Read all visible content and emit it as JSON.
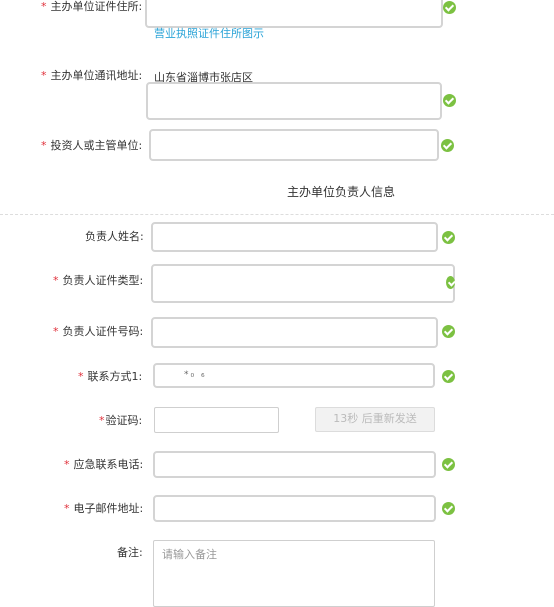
{
  "required_mark": "*",
  "fields": {
    "cert_address": {
      "label": "主办单位证件住所:",
      "link": "营业执照证件住所图示"
    },
    "mail_address": {
      "label": "主办单位通讯地址:",
      "prefix": "山东省淄博市张店区"
    },
    "investor": {
      "label": "投资人或主管单位:"
    },
    "section_title": "主办单位负责人信息",
    "leader_name": {
      "label": "负责人姓名:"
    },
    "leader_id_type": {
      "label": "负责人证件类型:"
    },
    "leader_id_no": {
      "label": "负责人证件号码:"
    },
    "contact1": {
      "label": "联系方式1:",
      "value": "*₀  ₆"
    },
    "verify_code": {
      "label": "验证码:",
      "resend": "13秒 后重新发送"
    },
    "emergency_phone": {
      "label": "应急联系电话:"
    },
    "email": {
      "label": "电子邮件地址:"
    },
    "remark": {
      "label": "备注:",
      "placeholder": "请输入备注"
    }
  },
  "colors": {
    "required": "#e0303a",
    "check": "#7cc142",
    "link": "#29a3d7",
    "border": "#d4d4d4"
  },
  "icons": {
    "valid": "check-circle-icon"
  }
}
